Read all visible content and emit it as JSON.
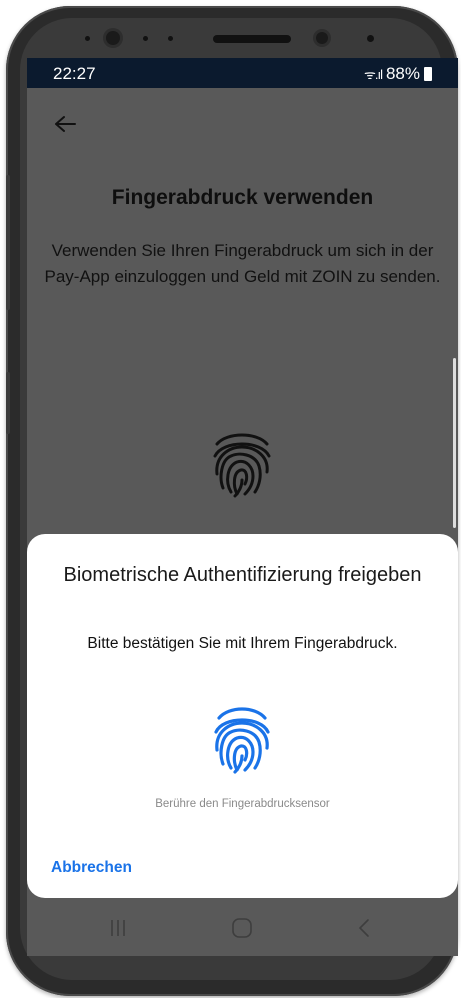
{
  "status_bar": {
    "time": "22:27",
    "signal_icons": "ᯤ.ıl",
    "battery": "88%"
  },
  "background": {
    "title": "Fingerabdruck verwenden",
    "body": "Verwenden Sie Ihren Fingerabdruck um sich in der Pay-App einzuloggen und Geld mit ZOIN zu senden."
  },
  "dialog": {
    "title": "Biometrische Authentifizierung freigeben",
    "subtitle": "Bitte bestätigen Sie mit Ihrem Fingerabdruck.",
    "hint": "Berühre den Fingerabdrucksensor",
    "cancel_label": "Abbrechen"
  },
  "icons": {
    "back": "arrow-left-icon",
    "fingerprint": "fingerprint-icon",
    "recents": "recent-apps-icon",
    "home": "home-icon",
    "back_nav": "back-chevron-icon"
  },
  "colors": {
    "accent": "#1a73e8",
    "scrim": "#595959",
    "status_bar": "#0b1a2e"
  }
}
